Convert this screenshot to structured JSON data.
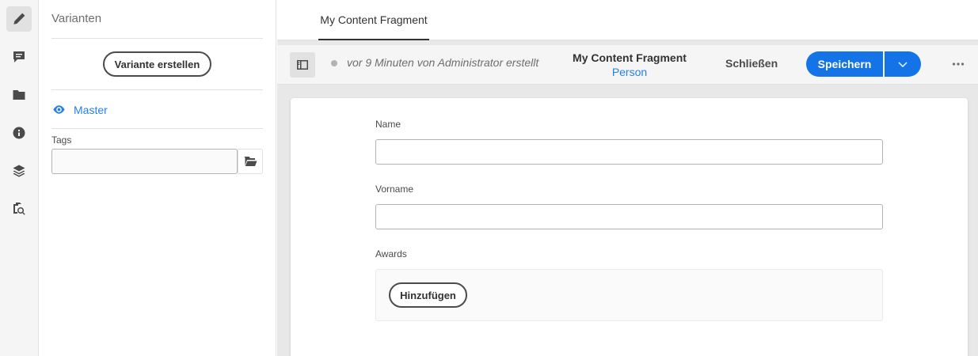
{
  "rail": {
    "icons": [
      "pencil-icon",
      "comment-icon",
      "folder-icon",
      "info-icon",
      "layers-icon",
      "asset-search-icon"
    ]
  },
  "panel": {
    "title": "Varianten",
    "create_variation_label": "Variante erstellen",
    "master_label": "Master",
    "tags_label": "Tags",
    "tags_value": ""
  },
  "tabs": [
    {
      "label": "My Content Fragment"
    }
  ],
  "toolbar": {
    "status_text": "vor 9 Minuten von Administrator erstellt",
    "fragment_title": "My Content Fragment",
    "fragment_model": "Person",
    "close_label": "Schließen",
    "save_label": "Speichern"
  },
  "form": {
    "fields": [
      {
        "label": "Name",
        "value": ""
      },
      {
        "label": "Vorname",
        "value": ""
      }
    ],
    "awards": {
      "label": "Awards",
      "add_label": "Hinzufügen"
    }
  },
  "colors": {
    "accent": "#1473e6",
    "link": "#2680eb",
    "rail_bg": "#f5f5f5",
    "canvas_bg": "#e8e8e8"
  }
}
